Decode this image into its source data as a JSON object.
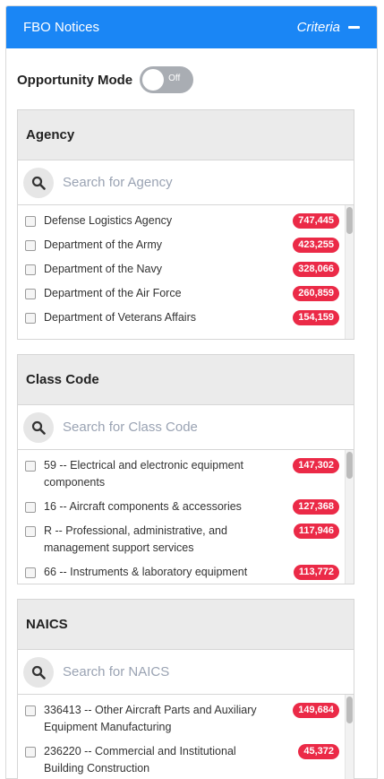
{
  "header": {
    "title": "FBO Notices",
    "criteria_label": "Criteria"
  },
  "mode": {
    "label": "Opportunity Mode",
    "toggle_text": "Off"
  },
  "agency": {
    "title": "Agency",
    "placeholder": "Search for Agency",
    "items": [
      {
        "label": "Defense Logistics Agency",
        "count": "747,445"
      },
      {
        "label": "Department of the Army",
        "count": "423,255"
      },
      {
        "label": "Department of the Navy",
        "count": "328,066"
      },
      {
        "label": "Department of the Air Force",
        "count": "260,859"
      },
      {
        "label": "Department of Veterans Affairs",
        "count": "154,159"
      }
    ]
  },
  "class_code": {
    "title": "Class Code",
    "placeholder": "Search for Class Code",
    "items": [
      {
        "label": "59 -- Electrical and electronic equipment components",
        "count": "147,302"
      },
      {
        "label": "16 -- Aircraft components & accessories",
        "count": "127,368"
      },
      {
        "label": "R -- Professional, administrative, and management support services",
        "count": "117,946"
      },
      {
        "label": "66 -- Instruments & laboratory equipment",
        "count": "113,772"
      }
    ]
  },
  "naics": {
    "title": "NAICS",
    "placeholder": "Search for NAICS",
    "items": [
      {
        "label": "336413 -- Other Aircraft Parts and Auxiliary Equipment Manufacturing",
        "count": "149,684"
      },
      {
        "label": "236220 -- Commercial and Institutional Building Construction",
        "count": "45,372"
      }
    ]
  },
  "colors": {
    "header": "#1a86f5",
    "badge": "#eb2a47",
    "toggle_off": "#a9adb3"
  },
  "icons": {
    "search": "search-icon",
    "collapse": "minus-icon"
  }
}
